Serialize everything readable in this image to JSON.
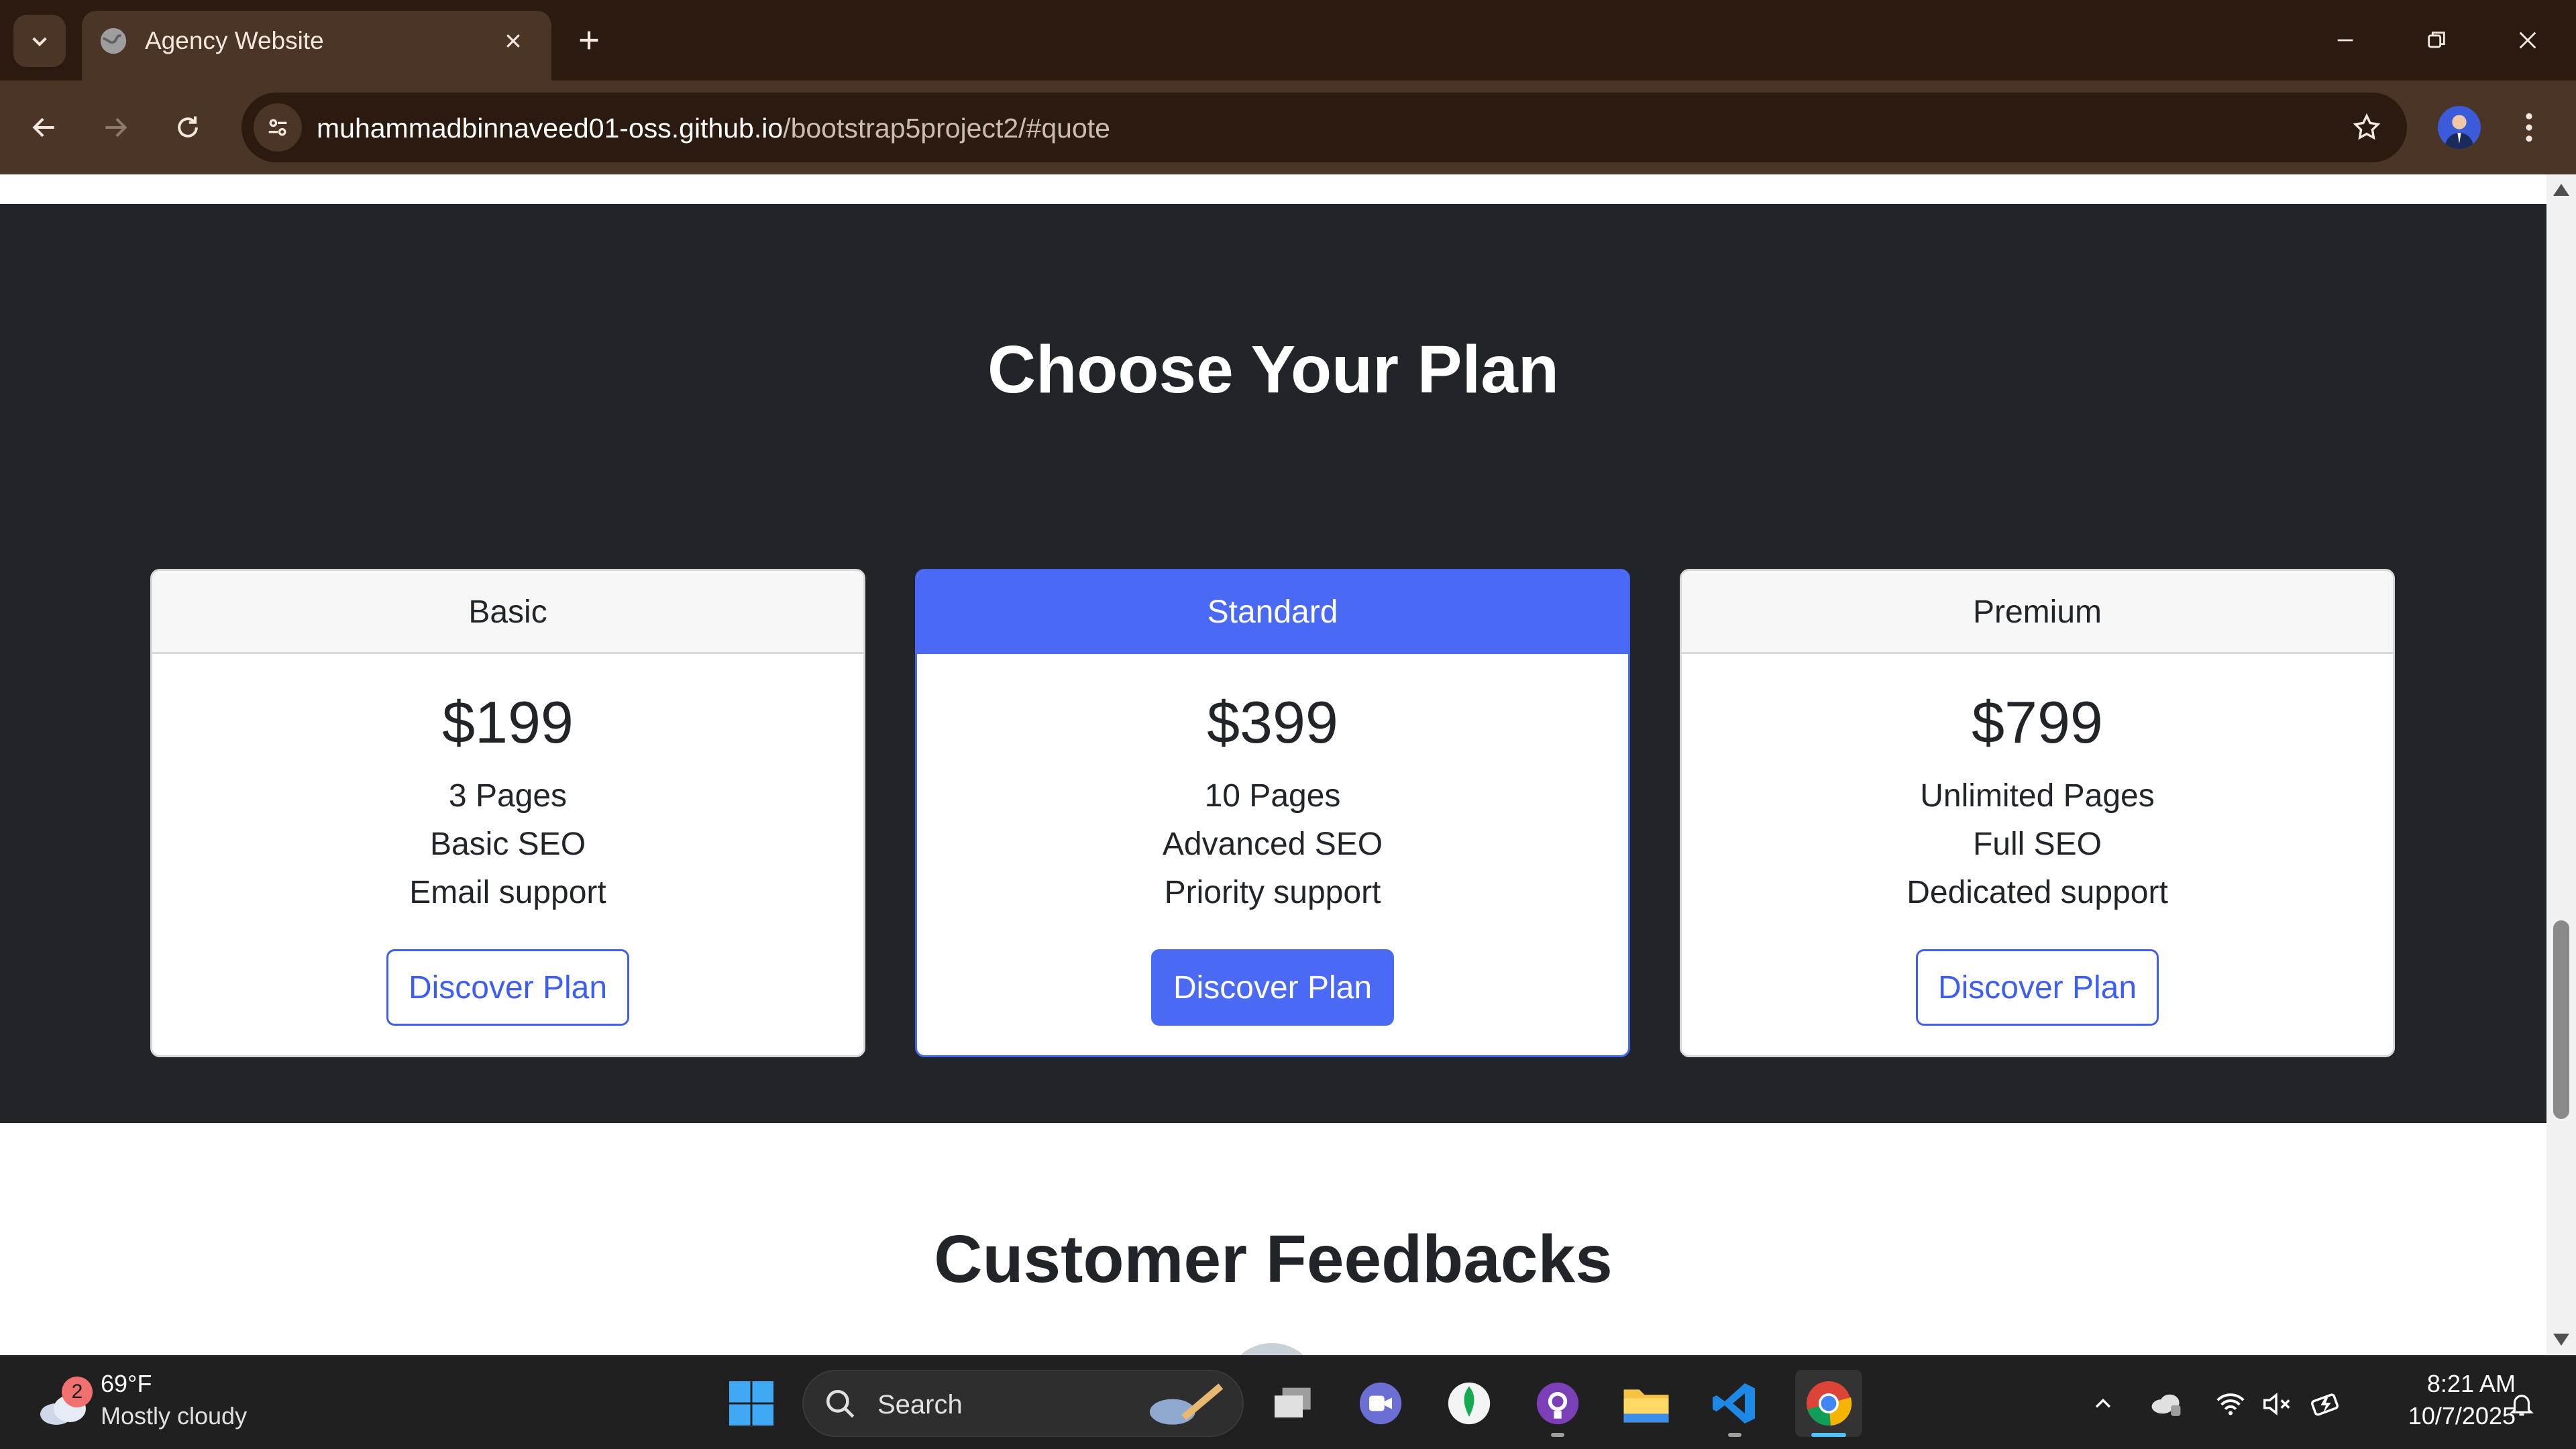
{
  "browser": {
    "tab_title": "Agency Website",
    "url_host": "muhammadbinnaveed01-oss.github.io",
    "url_path": "/bootstrap5project2/#quote",
    "theme_color": "#4a3526"
  },
  "plans_section": {
    "title": "Choose Your Plan",
    "background": "#212529",
    "accent": "#4a69f5",
    "cards": [
      {
        "name": "Basic",
        "price": "$199",
        "features": [
          "3 Pages",
          "Basic SEO",
          "Email support"
        ],
        "button": "Discover Plan"
      },
      {
        "name": "Standard",
        "price": "$399",
        "features": [
          "10 Pages",
          "Advanced SEO",
          "Priority support"
        ],
        "button": "Discover Plan"
      },
      {
        "name": "Premium",
        "price": "$799",
        "features": [
          "Unlimited Pages",
          "Full SEO",
          "Dedicated support"
        ],
        "button": "Discover Plan"
      }
    ]
  },
  "feedback_section": {
    "title": "Customer Feedbacks"
  },
  "taskbar": {
    "weather_badge": "2",
    "weather_temp": "69°F",
    "weather_desc": "Mostly cloudy",
    "search_label": "Search",
    "time": "8:21 AM",
    "date": "10/7/2025"
  }
}
